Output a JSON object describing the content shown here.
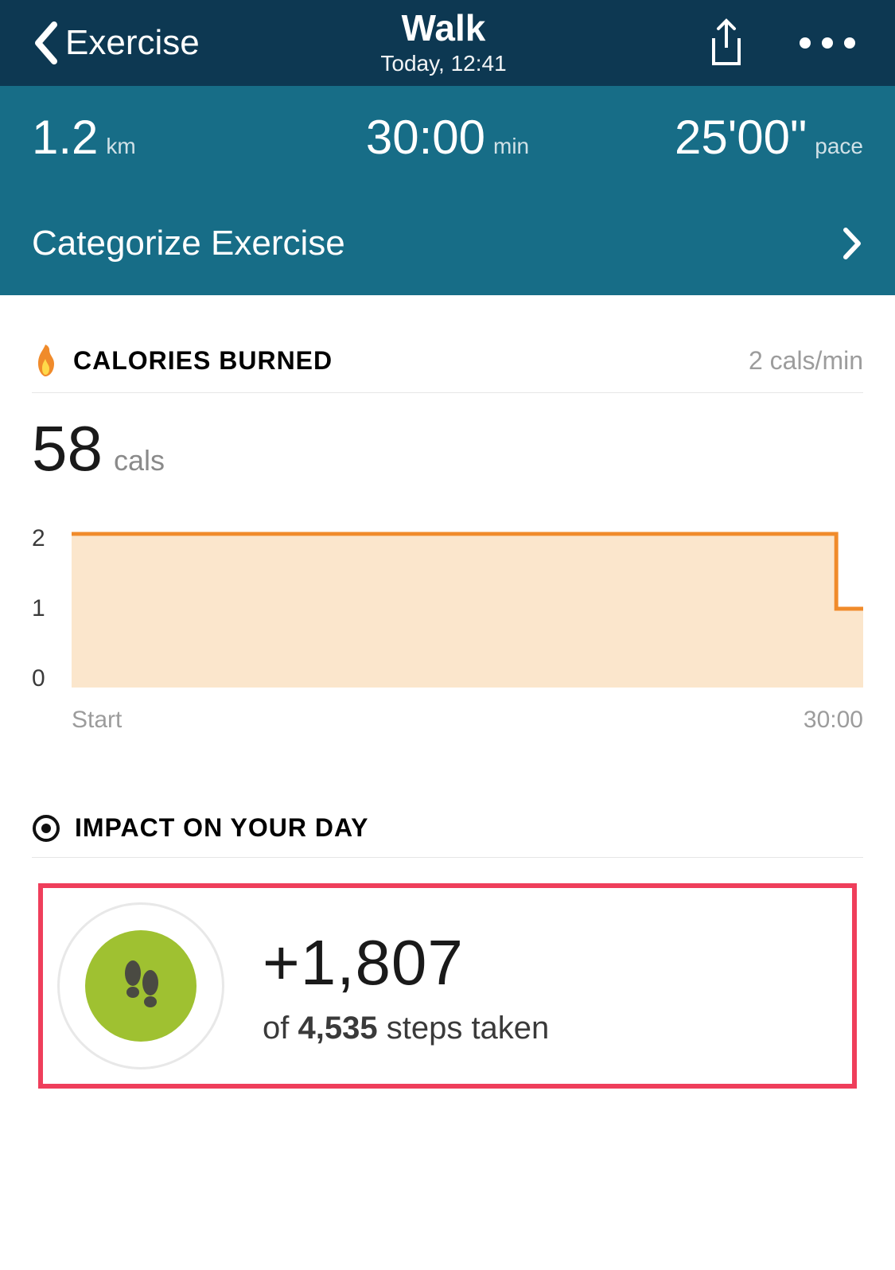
{
  "header": {
    "back_label": "Exercise",
    "title": "Walk",
    "subtitle": "Today, 12:41"
  },
  "stats": {
    "distance_value": "1.2",
    "distance_unit": "km",
    "duration_value": "30:00",
    "duration_unit": "min",
    "pace_value": "25'00\"",
    "pace_unit": "pace",
    "categorize_label": "Categorize Exercise"
  },
  "calories": {
    "section_title": "CALORIES BURNED",
    "rate": "2 cals/min",
    "total_value": "58",
    "total_unit": "cals"
  },
  "chart_data": {
    "type": "area",
    "xlabel": "",
    "ylabel": "",
    "ylim": [
      0,
      2
    ],
    "yticks": [
      "2",
      "1",
      "0"
    ],
    "x_start_label": "Start",
    "x_end_label": "30:00",
    "x": [
      0,
      29,
      30
    ],
    "values": [
      1.95,
      1.95,
      1.0
    ],
    "line_color": "#f08b2b",
    "fill_color": "#fbe6cc"
  },
  "impact": {
    "section_title": "IMPACT ON YOUR DAY",
    "steps_delta": "+1,807",
    "of_word": "of",
    "steps_total": "4,535",
    "steps_suffix": "steps taken"
  },
  "colors": {
    "navy": "#0d3852",
    "teal": "#176d87",
    "orange": "#f08b2b",
    "orange_fill": "#fbe6cc",
    "highlight_border": "#ef3e5b",
    "badge_green": "#9fc131"
  }
}
